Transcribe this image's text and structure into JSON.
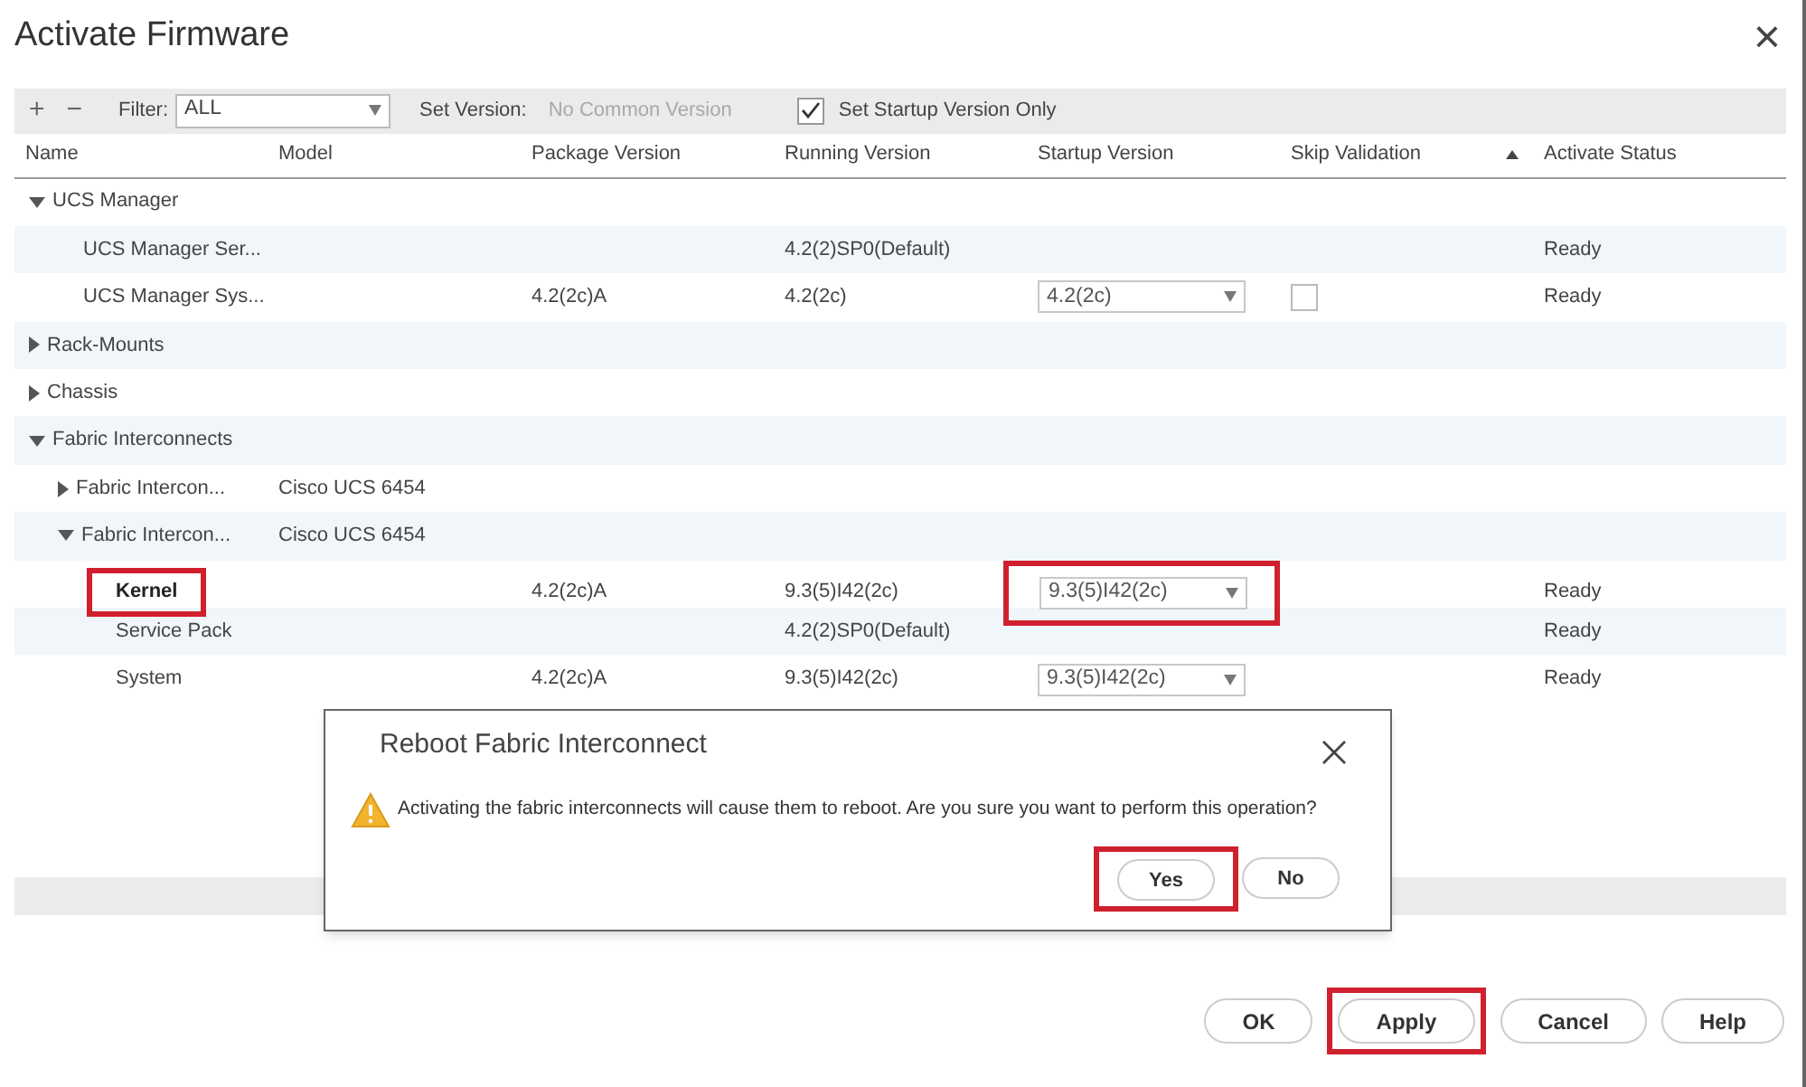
{
  "window": {
    "title": "Activate Firmware",
    "close": "×"
  },
  "toolbar": {
    "add": "+",
    "remove": "−",
    "filter_label": "Filter:",
    "filter_value": "ALL",
    "set_version_label": "Set Version:",
    "set_version_value": "No Common Version",
    "startup_only": {
      "label": "Set Startup Version Only",
      "checked": true
    }
  },
  "table": {
    "columns": [
      {
        "label": "Name"
      },
      {
        "label": "Model"
      },
      {
        "label": "Package Version"
      },
      {
        "label": "Running Version"
      },
      {
        "label": "Startup Version"
      },
      {
        "label": "Skip Validation",
        "sorted": true
      },
      {
        "label": "Activate Status"
      }
    ],
    "rows": [
      {
        "name": "UCS Manager",
        "expanded": true,
        "children": [
          {
            "name": "UCS Manager Ser...",
            "running": "4.2(2)SP0(Default)",
            "status": "Ready"
          },
          {
            "name": "UCS Manager Sys...",
            "package": "4.2(2c)A",
            "running": "4.2(2c)",
            "startup": {
              "value": "4.2(2c)",
              "highlighted": false
            },
            "skip": {
              "checked": false
            },
            "status": "Ready"
          }
        ]
      },
      {
        "name": "Rack-Mounts",
        "expanded": false
      },
      {
        "name": "Chassis",
        "expanded": false
      },
      {
        "name": "Fabric Interconnects",
        "expanded": true,
        "children": [
          {
            "name": "Fabric Intercon...",
            "model": "Cisco UCS 6454",
            "expanded": false
          },
          {
            "name": "Fabric Intercon...",
            "model": "Cisco UCS 6454",
            "expanded": true,
            "children": [
              {
                "name": "Kernel",
                "bold": true,
                "highlighted": true,
                "package": "4.2(2c)A",
                "running": "9.3(5)I42(2c)",
                "startup": {
                  "value": "9.3(5)I42(2c)",
                  "highlighted": true
                },
                "status": "Ready"
              },
              {
                "name": "Service Pack",
                "running": "4.2(2)SP0(Default)",
                "status": "Ready"
              },
              {
                "name": "System",
                "package": "4.2(2c)A",
                "running": "9.3(5)I42(2c)",
                "startup": {
                  "value": "9.3(5)I42(2c)",
                  "highlighted": false
                },
                "status": "Ready"
              }
            ]
          }
        ]
      }
    ]
  },
  "dialog": {
    "title": "Reboot Fabric Interconnect",
    "message": "Activating the fabric interconnects will cause them to reboot. Are you sure you want to perform this operation?",
    "buttons": [
      {
        "label": "Yes",
        "highlighted": true
      },
      {
        "label": "No",
        "highlighted": false
      }
    ]
  },
  "buttons": [
    {
      "label": "OK",
      "highlighted": false
    },
    {
      "label": "Apply",
      "highlighted": true
    },
    {
      "label": "Cancel",
      "highlighted": false
    },
    {
      "label": "Help",
      "highlighted": false
    }
  ]
}
